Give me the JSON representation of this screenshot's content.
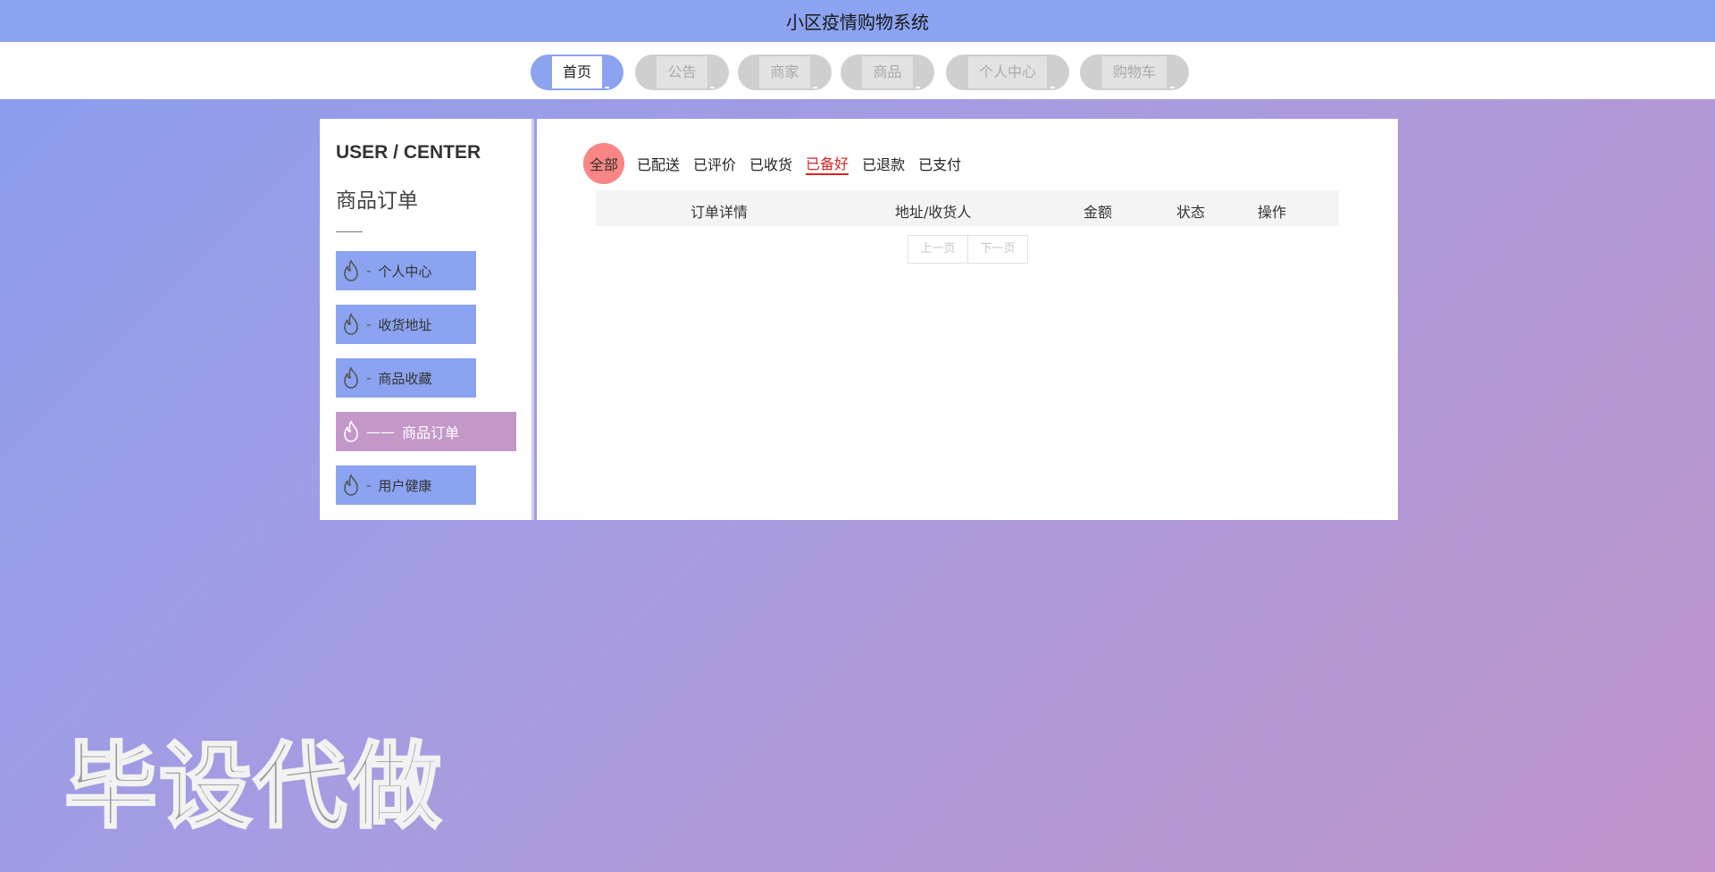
{
  "header": {
    "title": "小区疫情购物系统"
  },
  "nav": {
    "items": [
      {
        "label": "首页",
        "active": true
      },
      {
        "label": "公告",
        "active": false
      },
      {
        "label": "商家",
        "active": false
      },
      {
        "label": "商品",
        "active": false
      },
      {
        "label": "个人中心",
        "active": false
      },
      {
        "label": "购物车",
        "active": false
      }
    ]
  },
  "sidebar": {
    "heading": "USER / CENTER",
    "subheading": "商品订单",
    "items": [
      {
        "label": "个人中心",
        "icon": "flame-icon"
      },
      {
        "label": "收货地址",
        "icon": "flame-icon"
      },
      {
        "label": "商品收藏",
        "icon": "flame-icon"
      },
      {
        "label": "商品订单",
        "icon": "flame-icon",
        "active": true
      },
      {
        "label": "用户健康",
        "icon": "flame-icon"
      }
    ]
  },
  "orders": {
    "tabs": [
      {
        "label": "全部"
      },
      {
        "label": "已配送"
      },
      {
        "label": "已评价"
      },
      {
        "label": "已收货"
      },
      {
        "label": "已备好",
        "current": true
      },
      {
        "label": "已退款"
      },
      {
        "label": "已支付"
      }
    ],
    "columns": [
      "订单详情",
      "地址/收货人",
      "金额",
      "状态",
      "操作"
    ],
    "pager": {
      "prev": "上一页",
      "next": "下一页"
    }
  },
  "watermark": {
    "text": "毕设代做"
  },
  "colors": {
    "accent": "#8ba3f0",
    "active_menu": "#c398c9",
    "current_tab": "#dd2222",
    "all_badge": "#f98585"
  }
}
